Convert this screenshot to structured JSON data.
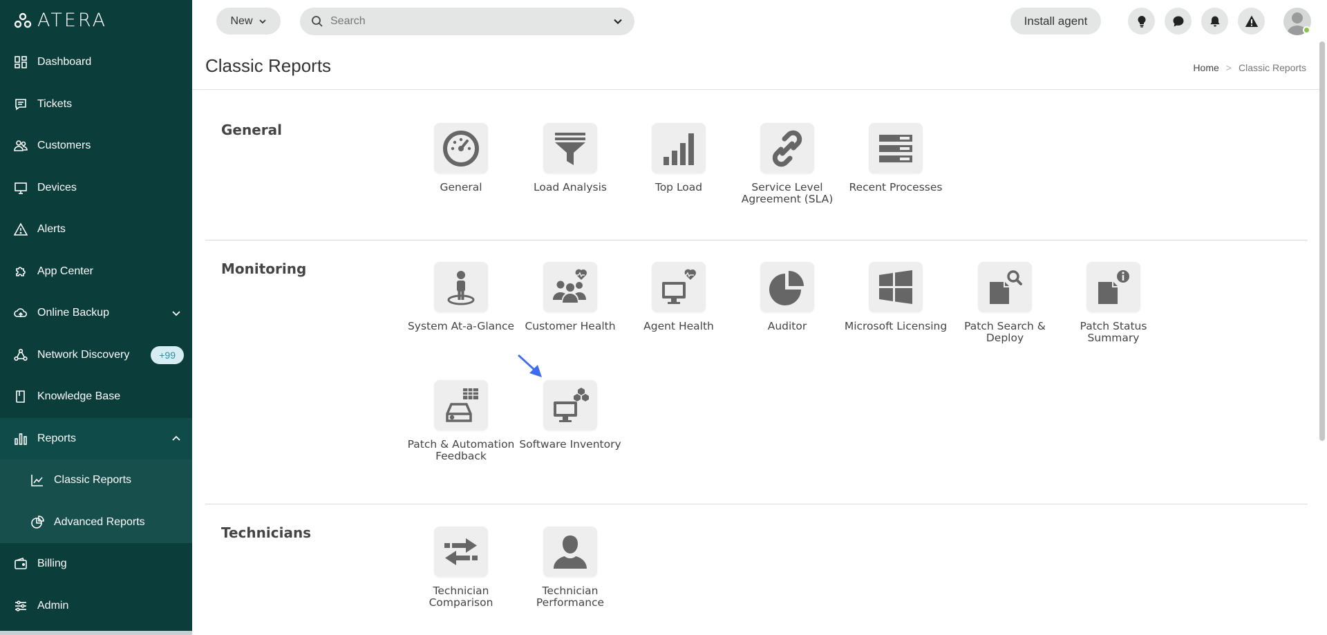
{
  "brand": {
    "name": "ATERA"
  },
  "sidebar": {
    "items": [
      {
        "label": "Dashboard",
        "icon": "dashboard-icon"
      },
      {
        "label": "Tickets",
        "icon": "ticket-icon"
      },
      {
        "label": "Customers",
        "icon": "customers-icon"
      },
      {
        "label": "Devices",
        "icon": "monitor-icon"
      },
      {
        "label": "Alerts",
        "icon": "alert-icon"
      },
      {
        "label": "App Center",
        "icon": "puzzle-icon"
      },
      {
        "label": "Online Backup",
        "icon": "cloud-icon"
      },
      {
        "label": "Network Discovery",
        "icon": "network-icon",
        "badge": "+99"
      },
      {
        "label": "Knowledge Base",
        "icon": "book-icon"
      },
      {
        "label": "Reports",
        "icon": "bar-chart-icon"
      },
      {
        "label": "Classic Reports",
        "icon": "line-chart-icon"
      },
      {
        "label": "Advanced Reports",
        "icon": "pie-chart-icon"
      },
      {
        "label": "Billing",
        "icon": "wallet-icon"
      },
      {
        "label": "Admin",
        "icon": "sliders-icon"
      }
    ]
  },
  "topbar": {
    "new_label": "New",
    "search_placeholder": "Search",
    "install_label": "Install agent"
  },
  "page": {
    "title": "Classic Reports",
    "breadcrumb": {
      "home": "Home",
      "sep": ">",
      "current": "Classic Reports"
    }
  },
  "sections": {
    "general": {
      "title": "General",
      "tiles": [
        "General",
        "Load Analysis",
        "Top Load",
        "Service Level Agreement (SLA)",
        "Recent Processes"
      ]
    },
    "monitoring": {
      "title": "Monitoring",
      "tiles": [
        "System At-a-Glance",
        "Customer Health",
        "Agent Health",
        "Auditor",
        "Microsoft Licensing",
        "Patch Search & Deploy",
        "Patch Status Summary",
        "Patch & Automation Feedback",
        "Software Inventory"
      ]
    },
    "technicians": {
      "title": "Technicians",
      "tiles": [
        "Technician Comparison",
        "Technician Performance"
      ]
    }
  },
  "colors": {
    "sidebar": "#0b3d3b",
    "icon_grey": "#666666",
    "tile_bg": "#eeeeee",
    "arrow": "#3d6cf0"
  }
}
